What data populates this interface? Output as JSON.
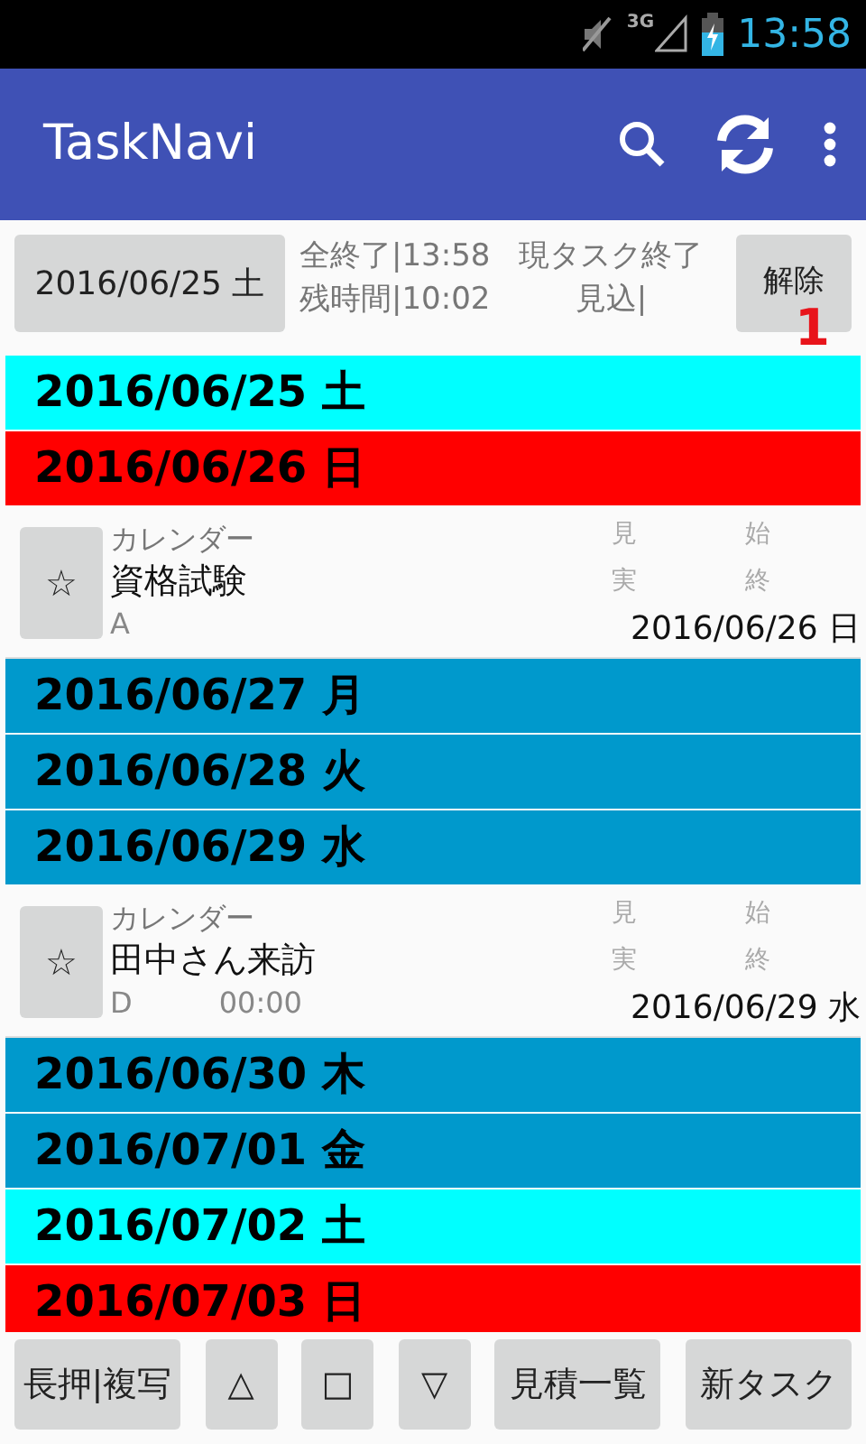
{
  "status_bar": {
    "network": "3G",
    "time": "13:58"
  },
  "app_bar": {
    "title": "TaskNavi"
  },
  "summary": {
    "date_button": "2016/06/25 土",
    "all_done": "全終了|13:58",
    "remaining": "残時間|10:02",
    "current_end": "現タスク終了",
    "estimate": "見込|",
    "release_button": "解除",
    "badge": "1"
  },
  "rows": [
    {
      "kind": "day",
      "date": "2016/06/25 土",
      "color": "#00ffff"
    },
    {
      "kind": "day",
      "date": "2016/06/26 日",
      "color": "#ff0000"
    },
    {
      "kind": "task",
      "star": "☆",
      "category": "カレンダー",
      "title": "資格試験",
      "priority": "A",
      "est": "見",
      "start": "始",
      "actual": "実",
      "end": "終",
      "date": "2016/06/26 日"
    },
    {
      "kind": "day",
      "date": "2016/06/27 月",
      "color": "#0099cc"
    },
    {
      "kind": "day",
      "date": "2016/06/28 火",
      "color": "#0099cc"
    },
    {
      "kind": "day",
      "date": "2016/06/29 水",
      "color": "#0099cc"
    },
    {
      "kind": "task",
      "star": "☆",
      "category": "カレンダー",
      "title": "田中さん来訪",
      "priority": "D",
      "time": "00:00",
      "est": "見",
      "start": "始",
      "actual": "実",
      "end": "終",
      "date": "2016/06/29 水"
    },
    {
      "kind": "day",
      "date": "2016/06/30 木",
      "color": "#0099cc"
    },
    {
      "kind": "day",
      "date": "2016/07/01 金",
      "color": "#0099cc"
    },
    {
      "kind": "day",
      "date": "2016/07/02 土",
      "color": "#00ffff"
    },
    {
      "kind": "day",
      "date": "2016/07/03 日",
      "color": "#ff0000"
    }
  ],
  "bottom_buttons": [
    "長押|複写",
    "△",
    "□",
    "▽",
    "見積一覧",
    "新タスク"
  ]
}
